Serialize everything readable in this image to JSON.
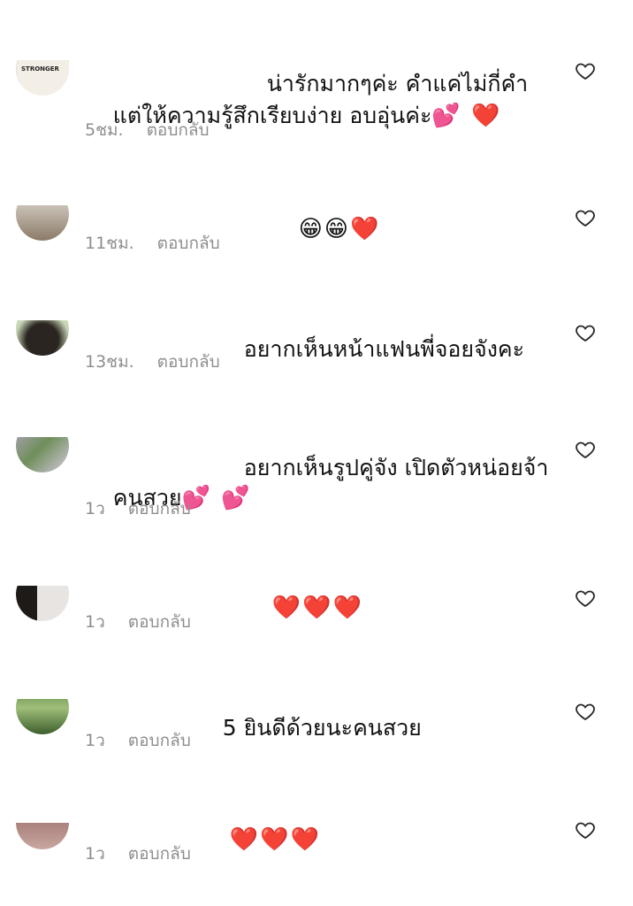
{
  "comments": [
    {
      "line1": "น่ารักมากๆค่ะ คำแค่ไม่กี่คำ",
      "line2": "แต่ให้ความรู้สึกเรียบง่าย อบอุ่นค่ะ",
      "emoji": "💕 ❤️",
      "time": "5ชม.",
      "reply": "ตอบกลับ",
      "avatar_text": "STRONGER"
    },
    {
      "line1": "",
      "emoji": "😁😁❤️",
      "time": "11ชม.",
      "reply": "ตอบกลับ"
    },
    {
      "line1": "อยากเห็นหน้าแฟนพี่จอยจังคะ",
      "time": "13ชม.",
      "reply": "ตอบกลับ"
    },
    {
      "line1": "อยากเห็นรูปคู่จัง เปิดตัวหน่อยจ้า",
      "line2": "คนสวย",
      "emoji": "💕 💕",
      "time": "1ว",
      "reply": "ตอบกลับ"
    },
    {
      "emoji": "❤️❤️❤️",
      "time": "1ว",
      "reply": "ตอบกลับ"
    },
    {
      "line1": "5 ยินดีด้วยนะคนสวย",
      "time": "1ว",
      "reply": "ตอบกลับ"
    },
    {
      "emoji": "❤️❤️❤️",
      "time": "1ว",
      "reply": "ตอบกลับ"
    }
  ],
  "colors": {
    "meta": "#8e8e8e",
    "text": "#111111",
    "like_icon": "#262626"
  },
  "icons": {
    "like": "heart-outline-icon"
  }
}
